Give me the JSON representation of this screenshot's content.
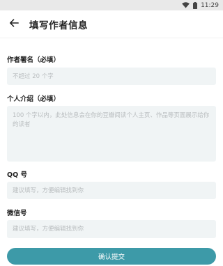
{
  "status_bar": {
    "time": "11:29",
    "wifi_icon": "wifi-icon",
    "battery_icon": "battery-icon"
  },
  "header": {
    "back_icon": "arrow-left-icon",
    "title": "填写作者信息"
  },
  "form": {
    "pen_name": {
      "label": "作者署名（必填）",
      "placeholder": "不超过 20 个字",
      "value": ""
    },
    "bio": {
      "label": "个人介绍（必填）",
      "placeholder": "100 个字以内，此处信息会在你的豆瓣阅读个人主页、作品等页面展示给你的读者",
      "value": ""
    },
    "qq": {
      "label": "QQ 号",
      "placeholder": "建议填写，方便编辑找到你",
      "value": ""
    },
    "wechat": {
      "label": "微信号",
      "placeholder": "建议填写，方便编辑找到你",
      "value": ""
    }
  },
  "submit_label": "确认提交",
  "colors": {
    "accent": "#3d9aa8",
    "field_bg": "#f0f4f5",
    "status_bar_bg": "#e9e9e9"
  }
}
